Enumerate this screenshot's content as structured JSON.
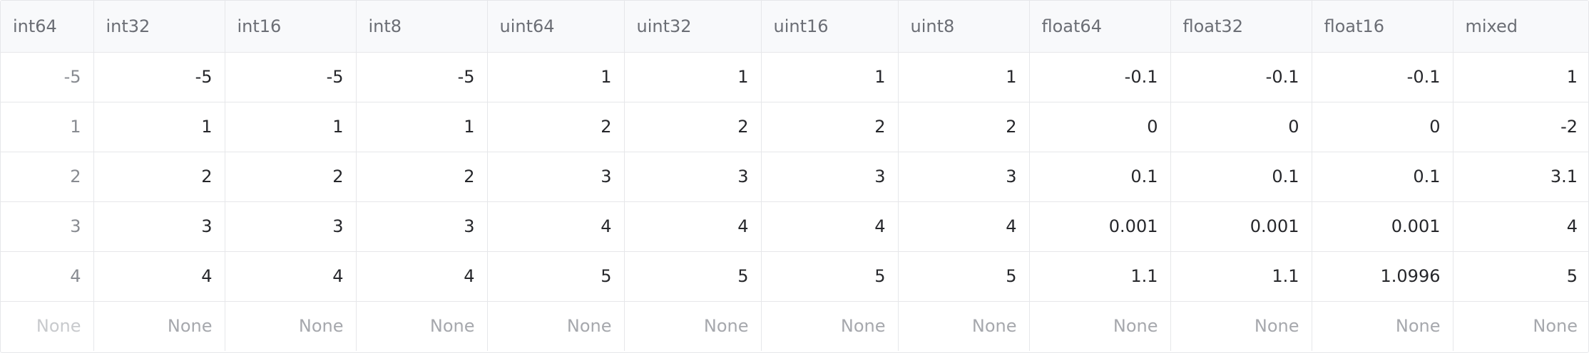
{
  "table": {
    "columns": [
      "int64",
      "int32",
      "int16",
      "int8",
      "uint64",
      "uint32",
      "uint16",
      "uint8",
      "float64",
      "float32",
      "float16",
      "mixed"
    ],
    "rows": [
      [
        "-5",
        "-5",
        "-5",
        "-5",
        "1",
        "1",
        "1",
        "1",
        "-0.1",
        "-0.1",
        "-0.1",
        "1"
      ],
      [
        "1",
        "1",
        "1",
        "1",
        "2",
        "2",
        "2",
        "2",
        "0",
        "0",
        "0",
        "-2"
      ],
      [
        "2",
        "2",
        "2",
        "2",
        "3",
        "3",
        "3",
        "3",
        "0.1",
        "0.1",
        "0.1",
        "3.1"
      ],
      [
        "3",
        "3",
        "3",
        "3",
        "4",
        "4",
        "4",
        "4",
        "0.001",
        "0.001",
        "0.001",
        "4"
      ],
      [
        "4",
        "4",
        "4",
        "4",
        "5",
        "5",
        "5",
        "5",
        "1.1",
        "1.1",
        "1.0996",
        "5"
      ],
      [
        "None",
        "None",
        "None",
        "None",
        "None",
        "None",
        "None",
        "None",
        "None",
        "None",
        "None",
        "None"
      ]
    ]
  }
}
